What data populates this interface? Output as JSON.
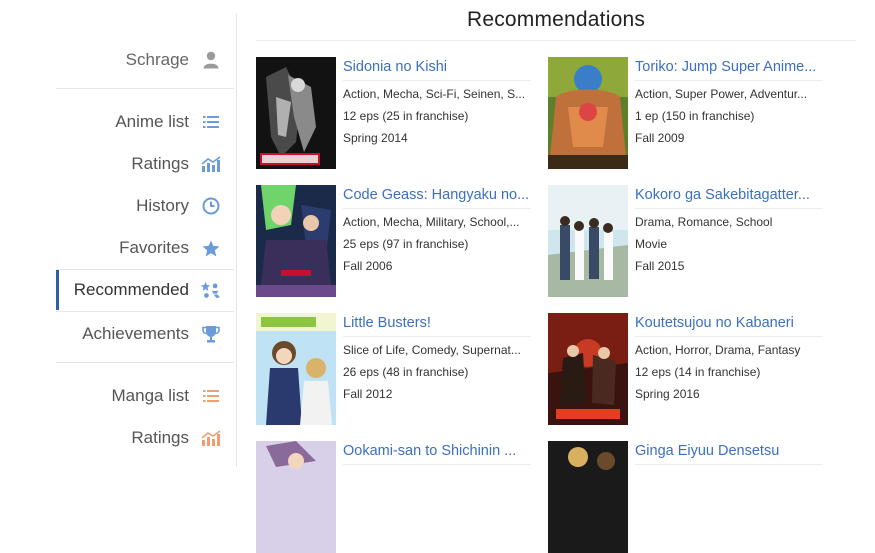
{
  "sidebar": {
    "user": {
      "label": "Schrage",
      "icon": "user-icon"
    },
    "anime_items": [
      {
        "label": "Anime list",
        "icon": "list-icon"
      },
      {
        "label": "Ratings",
        "icon": "ratings-chart-icon"
      },
      {
        "label": "History",
        "icon": "history-clock-icon"
      },
      {
        "label": "Favorites",
        "icon": "star-icon"
      },
      {
        "label": "Recommended",
        "icon": "recommended-icon",
        "active": true
      },
      {
        "label": "Achievements",
        "icon": "trophy-icon"
      }
    ],
    "manga_items": [
      {
        "label": "Manga list",
        "icon": "list-icon"
      },
      {
        "label": "Ratings",
        "icon": "ratings-chart-icon"
      }
    ],
    "colors": {
      "anime_icon": "#6b9bd8",
      "manga_icon": "#f0a070",
      "active_border": "#2b5fa8",
      "user_icon": "#9a9a9a"
    }
  },
  "main": {
    "title": "Recommendations",
    "cards": [
      {
        "name": "Sidonia no Kishi",
        "genres": "Action, Mecha, Sci-Fi, Seinen, S...",
        "episodes": "12 eps (25 in franchise)",
        "season": "Spring 2014"
      },
      {
        "name": "Toriko: Jump Super Anime...",
        "genres": "Action, Super Power, Adventur...",
        "episodes": "1 ep (150 in franchise)",
        "season": "Fall 2009"
      },
      {
        "name": "Code Geass: Hangyaku no...",
        "genres": "Action, Mecha, Military, School,...",
        "episodes": "25 eps (97 in franchise)",
        "season": "Fall 2006"
      },
      {
        "name": "Kokoro ga Sakebitagatter...",
        "genres": "Drama, Romance, School",
        "episodes": "Movie",
        "season": "Fall 2015"
      },
      {
        "name": "Little Busters!",
        "genres": "Slice of Life, Comedy, Supernat...",
        "episodes": "26 eps (48 in franchise)",
        "season": "Fall 2012"
      },
      {
        "name": "Koutetsujou no Kabaneri",
        "genres": "Action, Horror, Drama, Fantasy",
        "episodes": "12 eps (14 in franchise)",
        "season": "Spring 2016"
      },
      {
        "name": "Ookami-san to Shichinin ...",
        "genres": "",
        "episodes": "",
        "season": ""
      },
      {
        "name": "Ginga Eiyuu Densetsu",
        "genres": "",
        "episodes": "",
        "season": ""
      }
    ]
  }
}
